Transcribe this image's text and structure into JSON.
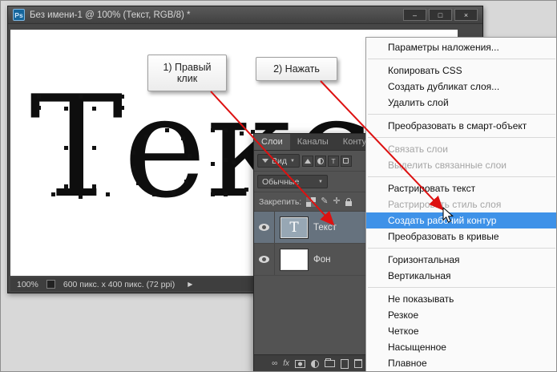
{
  "colors": {
    "menu_highlight": "#3e92e8",
    "arrow_red": "#dd1111",
    "selected_layer": "#66727e"
  },
  "icons": {
    "app_logo": "Ps",
    "minimize": "–",
    "maximize": "□",
    "close": "×",
    "caret_down": "▼",
    "arrow_right": "▶",
    "fx": "fx",
    "link": "∞",
    "brush": "✎",
    "move": "✛",
    "type_t": "T"
  },
  "window": {
    "title": "Без имени-1 @ 100% (Текст, RGB/8) *"
  },
  "canvas": {
    "text": "Текст"
  },
  "status_bar": {
    "zoom": "100%",
    "doc_size": "600 пикс. x 400 пикс. (72 ppi)"
  },
  "callouts": [
    {
      "label": "1) Правый клик"
    },
    {
      "label": "2) Нажать"
    }
  ],
  "layers_panel": {
    "tabs": [
      {
        "label": "Слои",
        "active": true
      },
      {
        "label": "Каналы",
        "active": false
      },
      {
        "label": "Контуры",
        "active": false
      }
    ],
    "filter_label": "Вид",
    "blend_mode": "Обычные",
    "lock_label": "Закрепить:",
    "layers": [
      {
        "name": "Текст",
        "thumb": "T",
        "selected": true
      },
      {
        "name": "Фон",
        "thumb": "",
        "selected": false
      }
    ]
  },
  "context_menu": {
    "items": [
      {
        "label": "Параметры наложения..."
      },
      {
        "type": "separator"
      },
      {
        "label": "Копировать CSS"
      },
      {
        "label": "Создать дубликат слоя..."
      },
      {
        "label": "Удалить слой"
      },
      {
        "type": "separator"
      },
      {
        "label": "Преобразовать в смарт-объект"
      },
      {
        "type": "separator"
      },
      {
        "label": "Связать слои",
        "disabled": true
      },
      {
        "label": "Выделить связанные слои",
        "disabled": true
      },
      {
        "type": "separator"
      },
      {
        "label": "Растрировать текст"
      },
      {
        "label": "Растрировать стиль слоя",
        "disabled": true
      },
      {
        "label": "Создать рабочий контур",
        "highlighted": true
      },
      {
        "label": "Преобразовать в кривые"
      },
      {
        "type": "separator"
      },
      {
        "label": "Горизонтальная"
      },
      {
        "label": "Вертикальная"
      },
      {
        "type": "separator"
      },
      {
        "label": "Не показывать"
      },
      {
        "label": "Резкое"
      },
      {
        "label": "Четкое"
      },
      {
        "label": "Насыщенное"
      },
      {
        "label": "Плавное"
      }
    ]
  }
}
